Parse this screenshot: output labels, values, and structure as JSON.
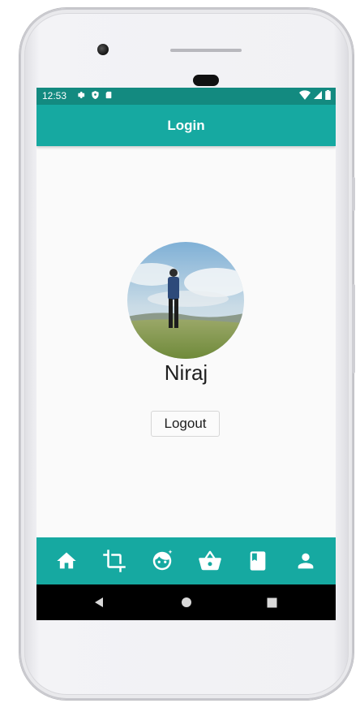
{
  "status_bar": {
    "time": "12:53",
    "left_icons": [
      "settings-icon",
      "shield-icon",
      "sd-card-icon"
    ],
    "right_icons": [
      "wifi-icon",
      "signal-icon",
      "battery-icon"
    ]
  },
  "app_bar": {
    "title": "Login"
  },
  "profile": {
    "name": "Niraj",
    "avatar": "avatar-photo"
  },
  "actions": {
    "logout_label": "Logout"
  },
  "bottom_nav": {
    "items": [
      {
        "icon": "home-icon"
      },
      {
        "icon": "crop-icon"
      },
      {
        "icon": "face-icon"
      },
      {
        "icon": "basket-icon"
      },
      {
        "icon": "book-icon"
      },
      {
        "icon": "person-icon"
      }
    ]
  },
  "system_nav": [
    "back-icon",
    "home-circle-icon",
    "recents-icon"
  ],
  "colors": {
    "primary": "#16a9a1",
    "primary_dark": "#138a80",
    "background": "#fafafa"
  }
}
